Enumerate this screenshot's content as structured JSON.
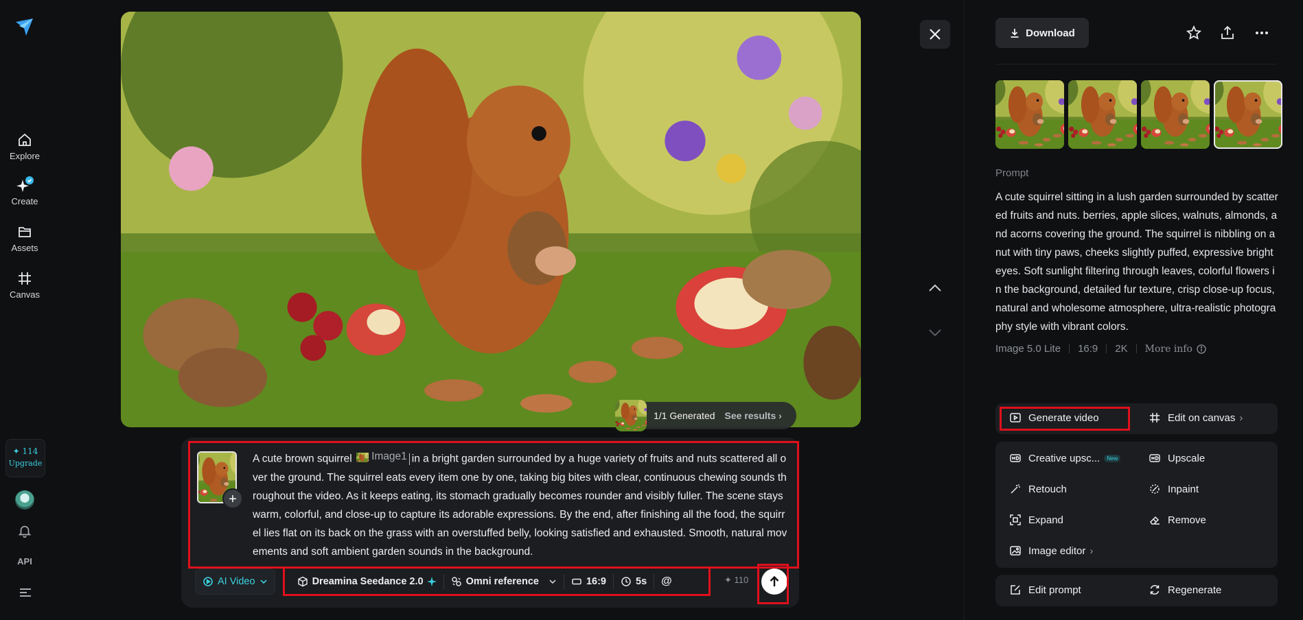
{
  "nav": {
    "items": [
      {
        "label": "Explore",
        "icon": "home-icon"
      },
      {
        "label": "Create",
        "icon": "create-sparkle-icon"
      },
      {
        "label": "Assets",
        "icon": "folder-icon"
      },
      {
        "label": "Canvas",
        "icon": "canvas-grid-icon"
      }
    ],
    "credits": "✦ 114",
    "upgrade_label": "Upgrade",
    "api_label": "API"
  },
  "viewer": {
    "generated_label": "1/1 Generated",
    "see_results_label": "See results",
    "see_results_chevron": "›"
  },
  "composer": {
    "prompt_before": "A cute brown squirrel",
    "image_ref_label": "Image1",
    "prompt_after": "in a bright garden surrounded by a huge variety of fruits and nuts scattered all over the ground. The squirrel eats every item one by one, taking big bites with clear, continuous chewing sounds throughout the video. As it keeps eating, its stomach gradually becomes rounder and visibly fuller. The scene stays warm, colorful, and close-up to capture its adorable expressions. By the end, after finishing all the food, the squirrel lies flat on its back on the grass with an overstuffed belly, looking satisfied and exhausted. Smooth, natural movements and soft ambient garden sounds in the background.",
    "add_label": "+",
    "mode_label": "AI Video",
    "model_label": "Dreamina Seedance 2.0",
    "reference_label": "Omni reference",
    "ratio_label": "16:9",
    "duration_label": "5s",
    "mention_label": "@",
    "cost_label": "✦ 110"
  },
  "panel": {
    "download_label": "Download",
    "prompt_heading": "Prompt",
    "prompt_text": "A cute squirrel sitting in a lush garden surrounded by scattered fruits and nuts. berries, apple slices, walnuts, almonds, and acorns covering the ground. The squirrel is nibbling on a nut with tiny paws, cheeks slightly puffed, expressive bright eyes. Soft sunlight filtering through leaves, colorful flowers in the background, detailed fur texture, crisp close-up focus, natural and wholesome atmosphere, ultra-realistic photography style with vibrant colors.",
    "meta_model": "Image 5.0 Lite",
    "meta_ratio": "16:9",
    "meta_res": "2K",
    "meta_more": "More info",
    "generate_video": "Generate video",
    "edit_on_canvas": "Edit on canvas",
    "creative_upscale": "Creative upsc...",
    "new_badge": "New",
    "upscale": "Upscale",
    "retouch": "Retouch",
    "inpaint": "Inpaint",
    "expand": "Expand",
    "remove": "Remove",
    "image_editor": "Image editor",
    "edit_prompt": "Edit prompt",
    "regenerate": "Regenerate",
    "chevron": "›"
  },
  "colors": {
    "accent": "#3ad0e0",
    "highlight": "#e0101c"
  }
}
